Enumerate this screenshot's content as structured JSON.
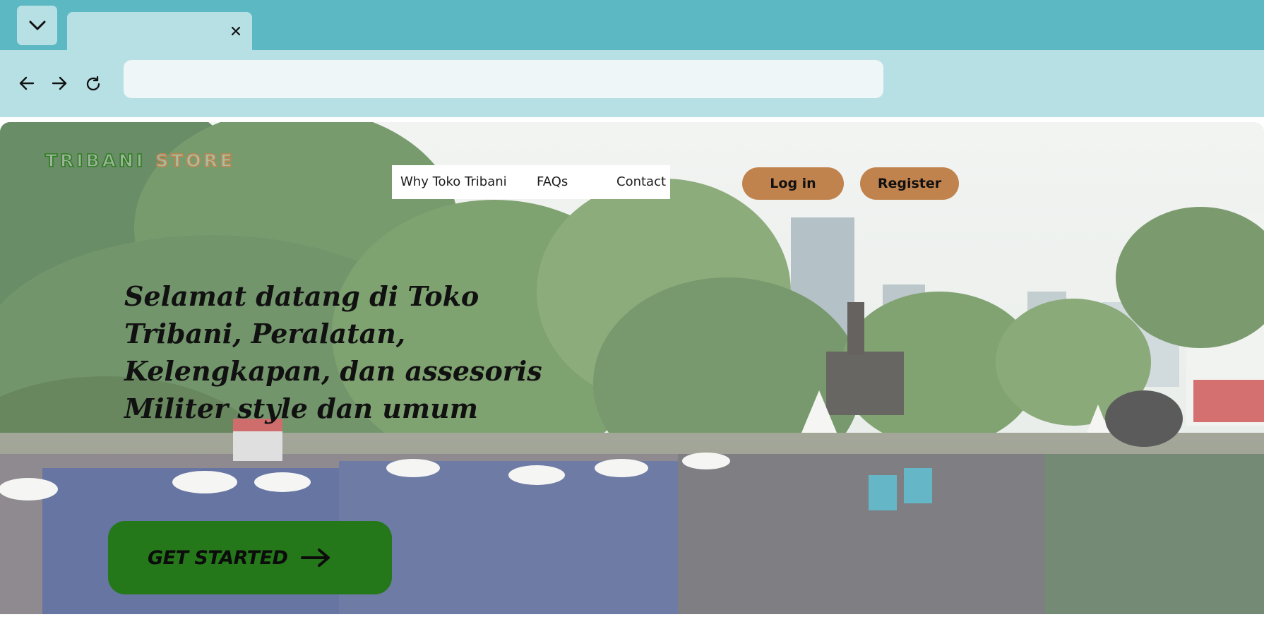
{
  "browser": {
    "tab_title": "",
    "url": "",
    "icons": {
      "tab_menu": "chevron-down-icon",
      "tab_close": "close-icon",
      "back": "arrow-left-icon",
      "forward": "arrow-right-icon",
      "reload": "reload-icon"
    }
  },
  "page": {
    "logo": {
      "word1": "TRIBANI",
      "word2": "STORE"
    },
    "nav": [
      {
        "label": "Why Toko Tribani"
      },
      {
        "label": "FAQs"
      },
      {
        "label": "Contact"
      }
    ],
    "auth": {
      "login_label": "Log in",
      "register_label": "Register"
    },
    "hero": {
      "headline": "Selamat datang di Toko Tribani, Peralatan, Kelengkapan, dan assesoris Militer style dan umum",
      "cta_label": "GET STARTED",
      "cta_icon": "arrow-right-icon",
      "background": "parade-photo"
    },
    "colors": {
      "chrome_dark": "#5cb8c3",
      "chrome_light": "#b7e0e5",
      "accent_brown": "#c1834d",
      "accent_green": "#25781a"
    }
  }
}
